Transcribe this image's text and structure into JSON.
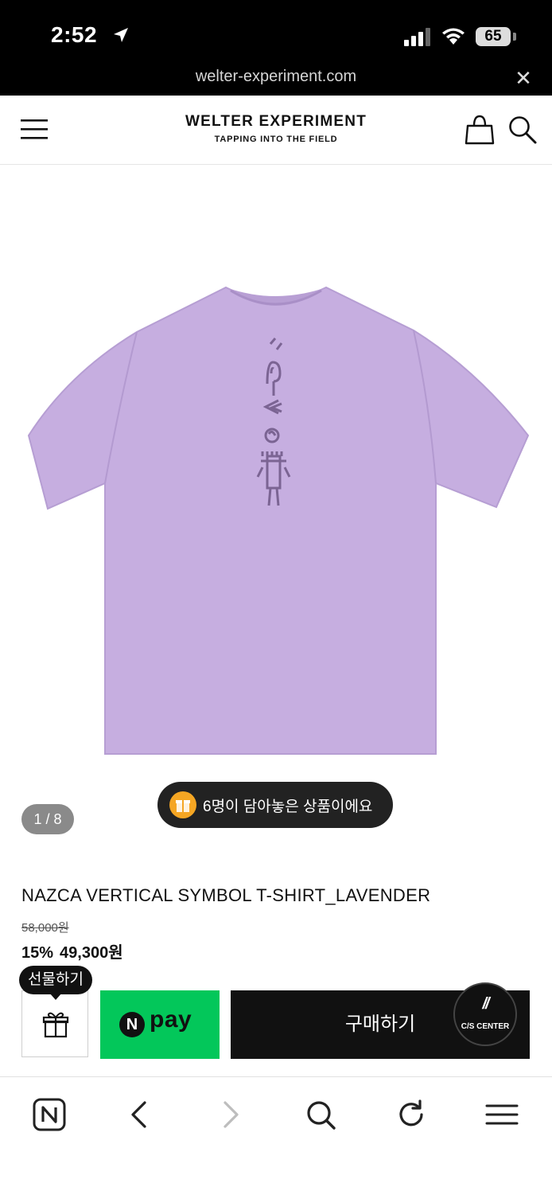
{
  "status_bar": {
    "time": "2:52",
    "battery": "65"
  },
  "browser": {
    "url": "welter-experiment.com",
    "close_icon": "close-icon"
  },
  "header": {
    "logo_title": "WELTER EXPERIMENT",
    "logo_subtitle": "TAPPING INTO THE FIELD",
    "icons": [
      "menu-icon",
      "shopping-bag-icon",
      "search-icon"
    ]
  },
  "gallery": {
    "counter": "1 / 8",
    "cart_badge": "6명이 담아놓은 상품이에요",
    "shirt_color": "#c6aee0"
  },
  "product": {
    "name": "NAZCA VERTICAL SYMBOL T-SHIRT_LAVENDER",
    "original_price": "58,000원",
    "discount": "15%",
    "sale_price": "49,300원"
  },
  "actions": {
    "gift_tooltip": "선물하기",
    "npay_n": "N",
    "npay_label": "pay",
    "buy_label": "구매하기",
    "cs_label": "C/S CENTER",
    "cs_mark": "//",
    "npay_color": "#03c75a"
  },
  "toolbar": {
    "icons": [
      "naver-home-icon",
      "back-icon",
      "forward-icon",
      "search-icon",
      "refresh-icon",
      "menu-icon"
    ]
  }
}
